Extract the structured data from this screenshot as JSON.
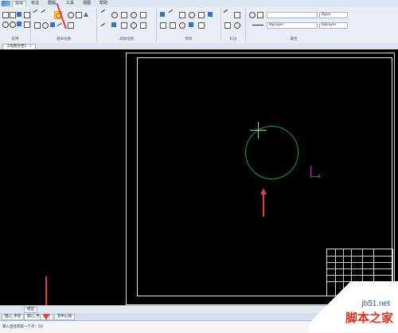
{
  "ribbon": {
    "tabs": [
      "常用",
      "标注",
      "图幅",
      "工具",
      "视图",
      "帮助"
    ],
    "active_tab": "常用",
    "panels": [
      "常用",
      "基本绘图",
      "高级绘图",
      "修改",
      "标注",
      "属性"
    ],
    "layer_dropdown": "ByLay",
    "linetype_dropdown": "ByLayer",
    "lineweight_dropdown": "ByLa",
    "color_dropdown": "ByLayer"
  },
  "document": {
    "tab_title": "工程图文档1",
    "close_glyph": "×"
  },
  "layout_tabs": [
    "模型"
  ],
  "command_tabs": [
    "圆心_半径",
    "圆心_半径2",
    "两点",
    "充中心线"
  ],
  "command_line": {
    "prompt": "输入直径或第一个点：50"
  },
  "watermark": {
    "site": "jb51.net",
    "name": "脚本之家"
  },
  "colors": {
    "canvas_bg": "#000000",
    "circle": "#1ba01b",
    "ucs": "#b030b0",
    "annotation": "#e43b3b"
  }
}
